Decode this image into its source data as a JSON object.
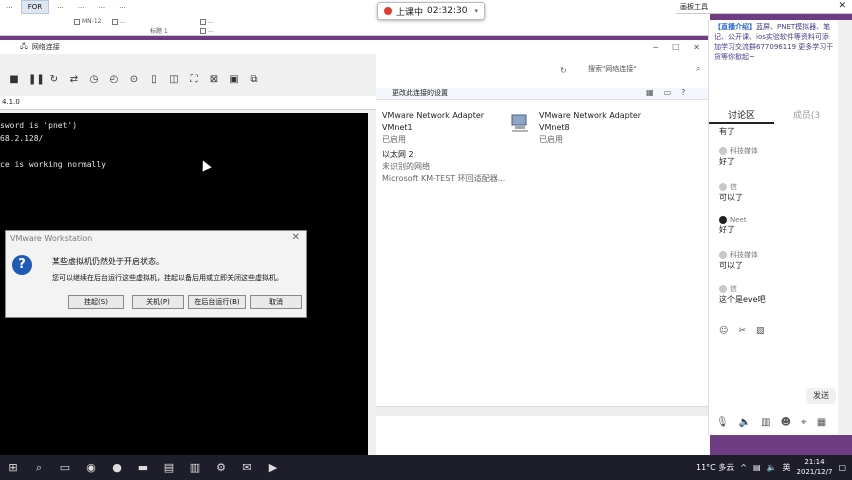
{
  "ribbon": {
    "tabs": [
      "...",
      "FOR",
      "...",
      "...",
      "...",
      "..."
    ],
    "opt_a": "MN-12",
    "opt_b": "...",
    "opt_c": "标题 1",
    "opt_d": "...",
    "opt_e": "..."
  },
  "live": {
    "status": "上课中",
    "time": "02:32:30"
  },
  "draw_tools": {
    "title": "画板工具"
  },
  "vm": {
    "window_title": "网络连接",
    "tab_label": "4.1.0",
    "console_lines": [
      "sword is 'pnet')",
      "68.2.128/",
      "",
      "ce is working normally"
    ]
  },
  "dialog": {
    "title": "VMware Workstation",
    "message_1": "某些虚拟机仍然处于开启状态。",
    "message_2": "您可以继续在后台运行这些虚拟机，挂起以备后用或立即关闭这些虚拟机。",
    "buttons": {
      "suspend": "挂起(S)",
      "poweroff": "关机(P)",
      "background": "在后台运行(B)",
      "cancel": "取消"
    }
  },
  "network": {
    "search_placeholder": "搜索\"网络连接\"",
    "command": "更改此连接的设置",
    "adapters": [
      {
        "name": "VMware Network Adapter",
        "line2": "VMnet1",
        "line3": "已启用"
      },
      {
        "name": "VMware Network Adapter",
        "line2": "VMnet8",
        "line3": "已启用"
      },
      {
        "name": "以太网 2",
        "line2": "未识别的网络",
        "line3": "Microsoft KM-TEST 环回适配器..."
      }
    ]
  },
  "side": {
    "intro_title": "【直播介绍】",
    "intro_text": "蓝屏、PNET模拟器、笔记、公开课、ios实验软件等资料可添加学习交流群677096119 更多学习干货等你掀起~",
    "tab_discuss": "讨论区",
    "tab_members": "成员(3",
    "messages": [
      {
        "name": "",
        "text": "有了",
        "avatar": "none"
      },
      {
        "name": "科技媒体",
        "text": "好了",
        "avatar": "light"
      },
      {
        "name": "信",
        "text": "可以了",
        "avatar": "light"
      },
      {
        "name": "Neet",
        "text": "好了",
        "avatar": "dark"
      },
      {
        "name": "科技媒体",
        "text": "可以了",
        "avatar": "light"
      },
      {
        "name": "信",
        "text": "这个是eve吧",
        "avatar": "light"
      }
    ],
    "send": "发送"
  },
  "taskbar": {
    "weather": "11°C 多云",
    "ime": "英",
    "time": "21:14",
    "date": "2021/12/7"
  }
}
